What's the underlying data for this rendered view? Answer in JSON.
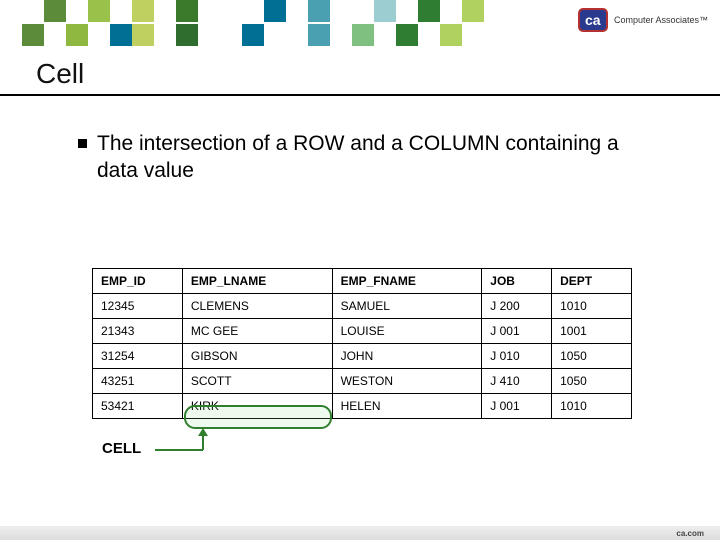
{
  "slide": {
    "title": "Cell",
    "bullet": "The intersection of a ROW and a COLUMN containing a data value",
    "cell_label": "CELL"
  },
  "logo": {
    "company": "Computer Associates™"
  },
  "footer": {
    "url": "ca.com"
  },
  "table": {
    "headers": [
      "EMP_ID",
      "EMP_LNAME",
      "EMP_FNAME",
      "JOB",
      "DEPT"
    ],
    "rows": [
      [
        "12345",
        "CLEMENS",
        "SAMUEL",
        "J 200",
        "1010"
      ],
      [
        "21343",
        "MC GEE",
        "LOUISE",
        "J 001",
        "1001"
      ],
      [
        "31254",
        "GIBSON",
        "JOHN",
        "J 010",
        "1050"
      ],
      [
        "43251",
        "SCOTT",
        "WESTON",
        "J 410",
        "1050"
      ],
      [
        "53421",
        "KIRK",
        "HELEN",
        "J 001",
        "1010"
      ]
    ]
  },
  "decor": {
    "top_colors": [
      "#fff",
      "#fff",
      "#5c8c3a",
      "#fff",
      "#9ac24a",
      "#fff",
      "#c0d060",
      "#fff",
      "#3a7a2a",
      "#fff",
      "#fff",
      "#fff",
      "#006f94",
      "#fff",
      "#4aa0b0",
      "#fff",
      "#fff",
      "#9bcdd1",
      "#fff",
      "#2e7d32",
      "#fff",
      "#b0d060",
      "#fff",
      "#fff",
      "#fff",
      "#fff",
      "#fff",
      "#fff",
      "#fff",
      "#fff",
      "#fff",
      "#fff",
      "#fff",
      "#5c8c3a",
      "#fff",
      "#8fb840",
      "#fff",
      "#006f94",
      "#c0d060",
      "#fff",
      "#2f6d2f",
      "#fff",
      "#fff",
      "#006f94",
      "#fff",
      "#fff",
      "#4aa0b0",
      "#fff",
      "#7fbf7f",
      "#fff",
      "#2e7d32",
      "#fff",
      "#b0d060",
      "#fff",
      "#fff",
      "#fff",
      "#fff",
      "#fff",
      "#fff",
      "#fff",
      "#fff",
      "#fff",
      "#fff",
      "#fff"
    ]
  }
}
